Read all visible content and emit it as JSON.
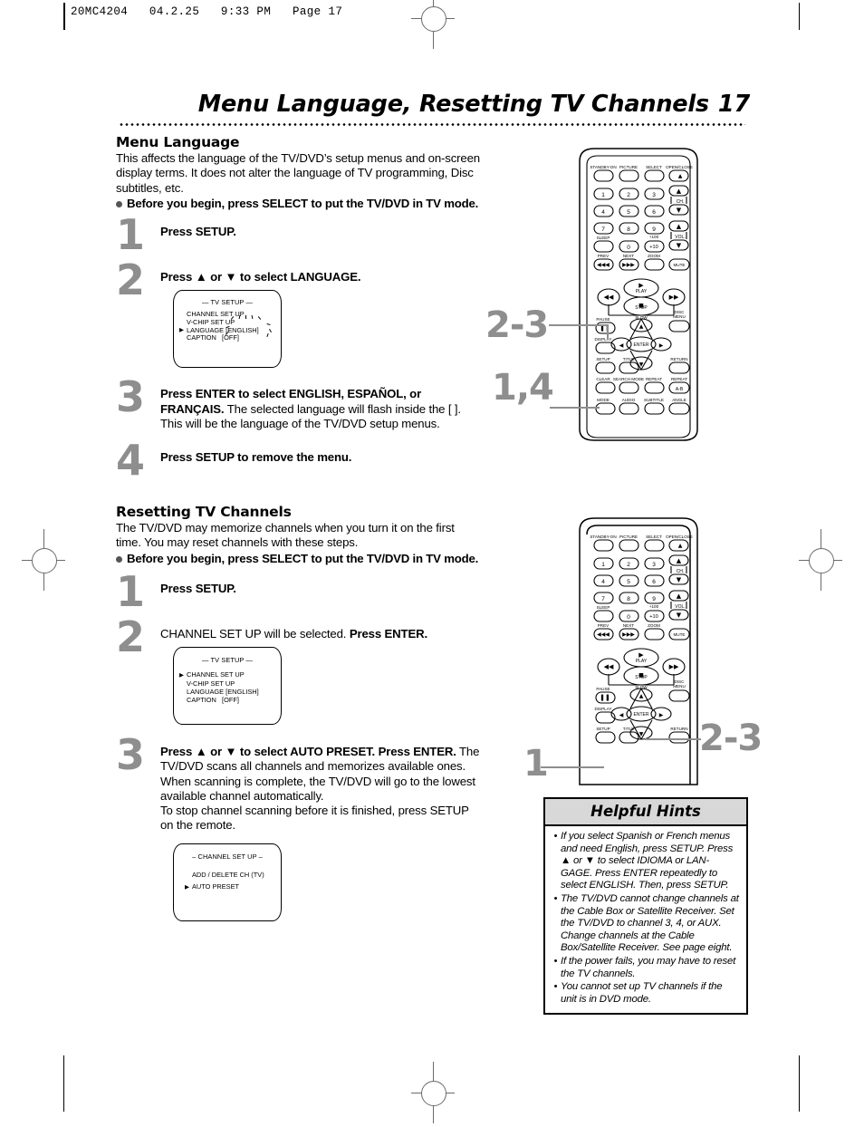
{
  "slug": "20MC4204   04.2.25   9:33 PM   Page 17",
  "page_title": "Menu Language, Resetting TV Channels",
  "page_number": "17",
  "section1": {
    "heading": "Menu Language",
    "intro": "This affects the language of the TV/DVD’s setup menus and on-screen display terms. It does not alter the language of TV programming, Disc subtitles, etc.",
    "bullet": "Before you begin, press SELECT to put the TV/DVD in TV mode.",
    "steps": [
      {
        "num": "1",
        "html": "<b>Press SETUP.</b>"
      },
      {
        "num": "2",
        "html": "<b>Press ▲ or ▼ to select LANGUAGE.</b>"
      },
      {
        "num": "3",
        "html": "<b>Press ENTER to select ENGLISH, ESPAÑOL, or FRANÇAIS.</b> The selected language will flash inside the [ ]. This will be the language of the TV/DVD setup menus."
      },
      {
        "num": "4",
        "html": "<b>Press SETUP to remove the menu.</b>"
      }
    ],
    "osd": {
      "title": "— TV SETUP —",
      "rows": [
        {
          "cursor": false,
          "label": "CHANNEL SET UP",
          "value": ""
        },
        {
          "cursor": false,
          "label": "V-CHIP SET UP",
          "value": ""
        },
        {
          "cursor": true,
          "label": "LANGUAGE",
          "value": "[ENGLISH]"
        },
        {
          "cursor": false,
          "label": "CAPTION",
          "value": "[OFF]"
        }
      ]
    }
  },
  "section2": {
    "heading": "Resetting TV Channels",
    "intro": "The TV/DVD may memorize channels when you turn it on the first time. You may reset channels with these steps.",
    "bullet": "Before you begin, press SELECT to put the TV/DVD in TV mode.",
    "steps": [
      {
        "num": "1",
        "html": "<b>Press SETUP.</b>"
      },
      {
        "num": "2",
        "html": "CHANNEL SET UP will be selected. <b>Press ENTER.</b>"
      },
      {
        "num": "3",
        "html": "<b>Press ▲ or ▼ to select AUTO PRESET. Press ENTER.</b> The TV/DVD scans all channels and memorizes available ones. When scanning is complete, the TV/DVD will go to the lowest available channel automatically.<br>To stop channel scanning before it is finished, press SETUP on the remote."
      }
    ],
    "osd": {
      "title": "— TV SETUP —",
      "rows": [
        {
          "cursor": true,
          "label": "CHANNEL SET UP",
          "value": ""
        },
        {
          "cursor": false,
          "label": "V-CHIP SET UP",
          "value": ""
        },
        {
          "cursor": false,
          "label": "LANGUAGE",
          "value": "[ENGLISH]"
        },
        {
          "cursor": false,
          "label": "CAPTION",
          "value": "[OFF]"
        }
      ]
    },
    "osd2": {
      "title": "– CHANNEL SET UP –",
      "rows": [
        {
          "cursor": false,
          "label": "ADD / DELETE CH (TV)"
        },
        {
          "cursor": true,
          "label": "AUTO PRESET"
        }
      ]
    }
  },
  "hints": {
    "title": "Helpful Hints",
    "bullet_char": "•",
    "items": [
      "If you select Spanish or French menus and need English, press SETUP. Press ▲ or ▼ to select IDIOMA or LAN-GAGE.  Press ENTER repeatedly to select ENGLISH. Then, press SETUP.",
      "The TV/DVD cannot change channels at the Cable Box or Satellite Receiver. Set the TV/DVD to channel 3, 4, or AUX. Change channels at the Cable Box/Satellite Receiver. See page eight.",
      "If the power fails, you may have to reset the TV channels.",
      "You cannot set up TV channels if the unit is in DVD mode."
    ]
  },
  "remote": {
    "row_top": [
      "STANDBY-ON",
      "PICTURE",
      "SELECT",
      "OPEN/CLOSE"
    ],
    "keypad": [
      "1",
      "2",
      "3",
      "4",
      "5",
      "6",
      "7",
      "8",
      "9",
      "0"
    ],
    "sleep_label": "SLEEP",
    "plus100_label": "+100",
    "plus10_label": "+10",
    "ch_label": "CH.",
    "vol_label": "VOL.",
    "prev_label": "PREV",
    "next_label": "NEXT",
    "zoom_label": "ZOOM",
    "mute_label": "MUTE",
    "play_label": "PLAY",
    "stop_label": "STOP",
    "pause_label": "PAUSE",
    "slow_label": "SLOW",
    "disc_menu_label": "DISC MENU",
    "display_label": "DISPLAY",
    "enter_label": "ENTER",
    "setup_label": "SETUP",
    "title_label": "TITLE",
    "return_label": "RETURN",
    "clear_label": "CLEAR",
    "search_mode_label": "SEARCH MODE",
    "repeat_label": "REPEAT",
    "repeat_ab_label": "REPEAT A-B",
    "ab_label": "A-B",
    "mode_label": "MODE",
    "audio_label": "AUDIO",
    "subtitle_label": "SUBTITLE",
    "angle_label": "ANGLE"
  },
  "callouts": {
    "r1_top": "2-3",
    "r1_bottom": "1,4",
    "r2_left": "1",
    "r2_right": "2-3"
  },
  "colors": {
    "step_number": "#8e8e8e",
    "hints_header_bg": "#d8d8d8",
    "ink": "#000000"
  }
}
